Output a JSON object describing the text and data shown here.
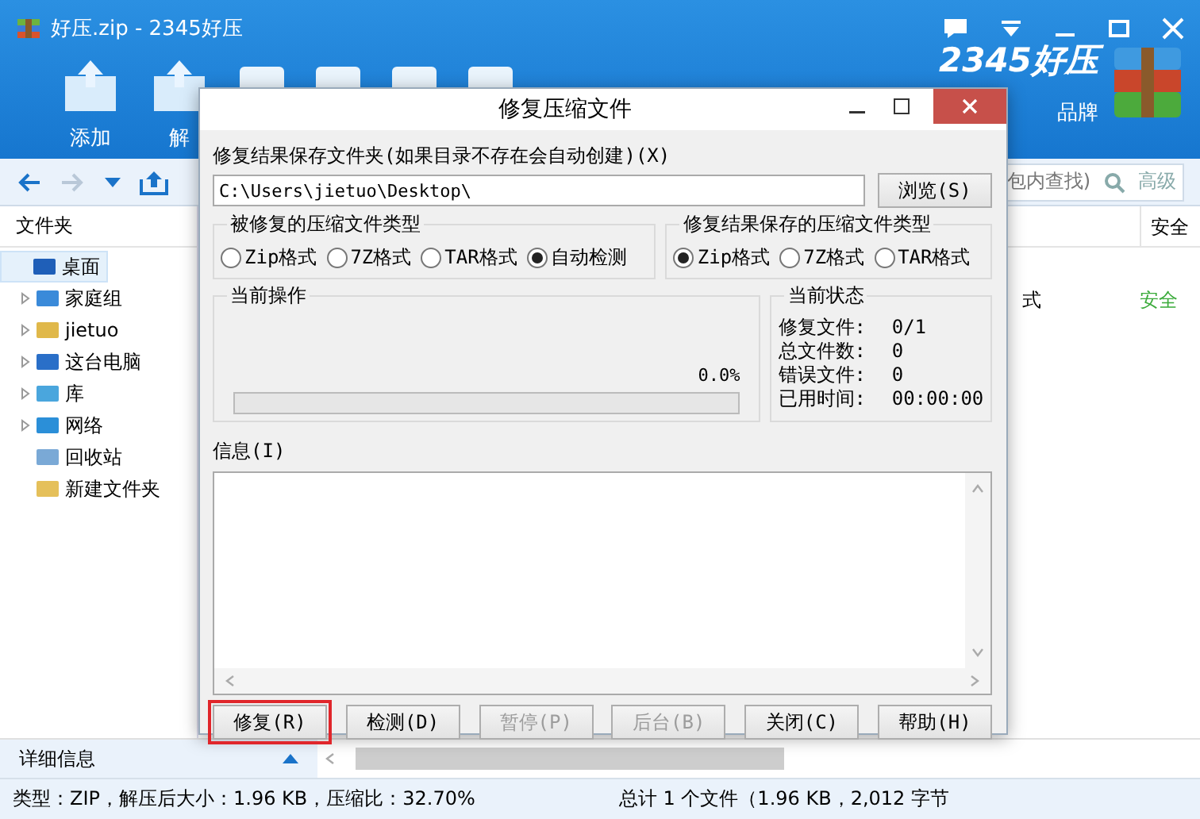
{
  "window": {
    "title": "好压.zip - 2345好压"
  },
  "toolbar": [
    {
      "label": "添加"
    },
    {
      "label": "解"
    }
  ],
  "brand": {
    "name": "2345好压",
    "slogan": "品牌"
  },
  "nav": {
    "search_placeholder": "包内查找)",
    "advanced": "高级"
  },
  "sidebar": {
    "header": "文件夹",
    "items": [
      {
        "label": "桌面",
        "expandable": false,
        "selected": true
      },
      {
        "label": "家庭组",
        "expandable": true,
        "selected": false
      },
      {
        "label": "jietuo",
        "expandable": true,
        "selected": false
      },
      {
        "label": "这台电脑",
        "expandable": true,
        "selected": false
      },
      {
        "label": "库",
        "expandable": true,
        "selected": false
      },
      {
        "label": "网络",
        "expandable": true,
        "selected": false
      },
      {
        "label": "回收站",
        "expandable": false,
        "selected": false
      },
      {
        "label": "新建文件夹",
        "expandable": false,
        "selected": false
      }
    ],
    "details": "详细信息"
  },
  "file_list": {
    "columns": [
      {
        "label": "安全"
      }
    ],
    "rows": [
      {
        "column_1": "式",
        "safety": "安全"
      }
    ]
  },
  "status_bar": {
    "left": "类型：ZIP，解压后大小：1.96 KB，压缩比：32.70%",
    "right": "总计 1 个文件（1.96 KB，2,012 字节"
  },
  "dialog": {
    "title": "修复压缩文件",
    "folder_label": "修复结果保存文件夹(如果目录不存在会自动创建)(X)",
    "folder_value": "C:\\Users\\jietuo\\Desktop\\",
    "browse": "浏览(S)",
    "source_group": {
      "title": "被修复的压缩文件类型",
      "options": [
        {
          "label": "Zip格式",
          "selected": false
        },
        {
          "label": "7Z格式",
          "selected": false
        },
        {
          "label": "TAR格式",
          "selected": false
        },
        {
          "label": "自动检测",
          "selected": true
        }
      ]
    },
    "target_group": {
      "title": "修复结果保存的压缩文件类型",
      "options": [
        {
          "label": "Zip格式",
          "selected": true
        },
        {
          "label": "7Z格式",
          "selected": false
        },
        {
          "label": "TAR格式",
          "selected": false
        }
      ]
    },
    "operation": {
      "title": "当前操作",
      "percent": "0.0%",
      "level": 0
    },
    "status": {
      "title": "当前状态",
      "rows": [
        {
          "label": "修复文件:",
          "value": "0/1"
        },
        {
          "label": "总文件数:",
          "value": "0"
        },
        {
          "label": "错误文件:",
          "value": "0"
        },
        {
          "label": "已用时间:",
          "value": "00:00:00"
        }
      ]
    },
    "info_label": "信息(I)",
    "buttons": [
      {
        "label": "修复(R)",
        "disabled": false,
        "highlighted": true
      },
      {
        "label": "检测(D)",
        "disabled": false,
        "highlighted": false
      },
      {
        "label": "暂停(P)",
        "disabled": true,
        "highlighted": false
      },
      {
        "label": "后台(B)",
        "disabled": true,
        "highlighted": false
      },
      {
        "label": "关闭(C)",
        "disabled": false,
        "highlighted": false
      },
      {
        "label": "帮助(H)",
        "disabled": false,
        "highlighted": false
      }
    ]
  }
}
